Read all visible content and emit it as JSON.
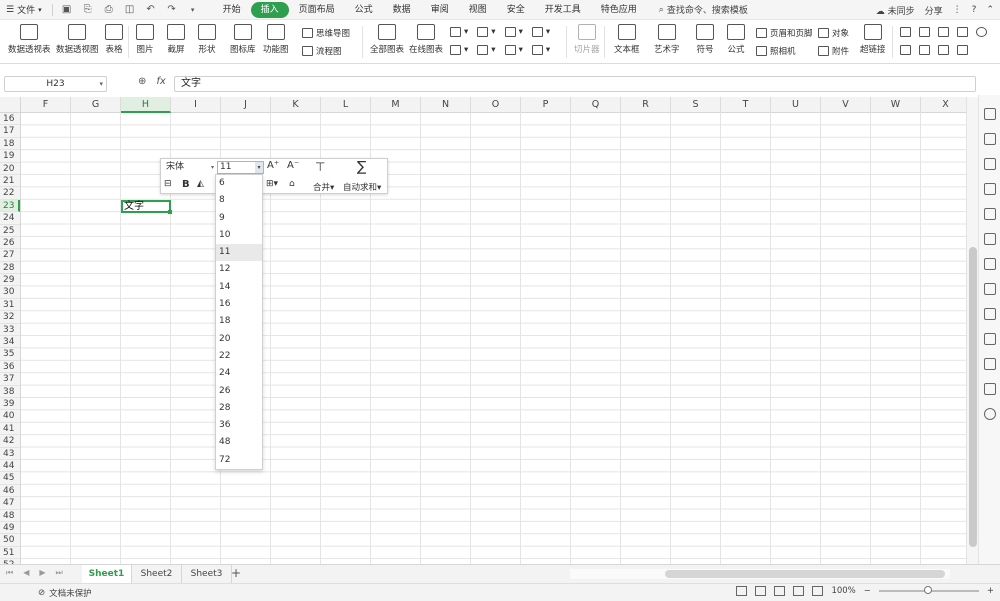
{
  "topbar": {
    "file_menu": "文件",
    "tabs": [
      "开始",
      "插入",
      "页面布局",
      "公式",
      "数据",
      "审阅",
      "视图",
      "安全",
      "开发工具",
      "特色应用"
    ],
    "active_tab_index": 1,
    "search_label": "查找命令、搜索模板",
    "sync_label": "未同步",
    "share_label": "分享"
  },
  "ribbon": {
    "pivot_table": "数据透视表",
    "pivot_chart": "数据透视图",
    "table": "表格",
    "picture": "图片",
    "screenshot": "截屏",
    "shapes": "形状",
    "icon_lib": "图标库",
    "func_chart": "功能图",
    "mind_map": "思维导图",
    "flow_chart": "流程图",
    "all_charts": "全部图表",
    "online_charts": "在线图表",
    "slicer": "切片器",
    "textbox": "文本框",
    "art_text": "艺术字",
    "symbol": "符号",
    "formula": "公式",
    "header_footer": "页眉和页脚",
    "camera": "照相机",
    "object": "对象",
    "attachment": "附件",
    "hyperlink": "超链接"
  },
  "formula_bar": {
    "cell_ref": "H23",
    "fx_label": "fx",
    "content": "文字"
  },
  "grid": {
    "columns": [
      "F",
      "G",
      "H",
      "I",
      "J",
      "K",
      "L",
      "M",
      "N",
      "O",
      "P",
      "Q",
      "R",
      "S",
      "T",
      "U",
      "V",
      "W",
      "X"
    ],
    "selected_column": "H",
    "rows": [
      "16",
      "17",
      "18",
      "19",
      "20",
      "21",
      "22",
      "23",
      "24",
      "25",
      "26",
      "27",
      "28",
      "29",
      "30",
      "31",
      "32",
      "33",
      "34",
      "35",
      "36",
      "37",
      "38",
      "39",
      "40",
      "41",
      "42",
      "43",
      "44",
      "45",
      "46",
      "47",
      "48",
      "49",
      "50",
      "51",
      "52"
    ],
    "selected_row": "23",
    "active_cell_value": "文字"
  },
  "minibar": {
    "font_name": "宋体",
    "font_size": "11",
    "grow_font": "A⁺",
    "shrink_font": "A⁻",
    "bold": "B",
    "merge_label": "合并",
    "autosum_label": "自动求和",
    "size_options": [
      "6",
      "8",
      "9",
      "10",
      "11",
      "12",
      "14",
      "16",
      "18",
      "20",
      "22",
      "24",
      "26",
      "28",
      "36",
      "48",
      "72"
    ],
    "highlighted_size": "11"
  },
  "sheets": {
    "tabs": [
      "Sheet1",
      "Sheet2",
      "Sheet3"
    ],
    "active_index": 0,
    "add_label": "+"
  },
  "status": {
    "protect_label": "文档未保护",
    "zoom_label": "100%"
  },
  "colors": {
    "accent": "#2e9e4f",
    "selection_bg": "#e1efe3"
  }
}
